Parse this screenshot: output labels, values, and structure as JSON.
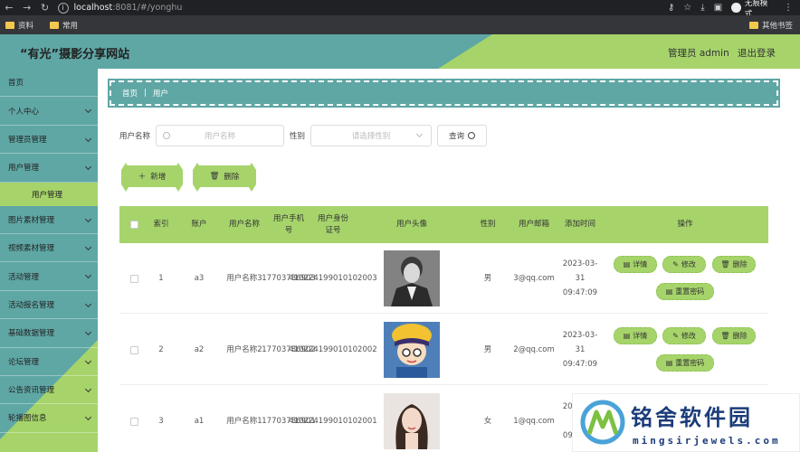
{
  "browser": {
    "url_host": "localhost",
    "url_path": ":8081/#/yonghu",
    "incognito_label": "无痕模式",
    "bookmarks": [
      "资料",
      "常用"
    ],
    "other_bookmarks": "其他书签"
  },
  "header": {
    "title": "“有光”摄影分享网站",
    "user": "管理员 admin",
    "logout": "退出登录"
  },
  "sidebar": {
    "items": [
      {
        "label": "首页",
        "chevron": false
      },
      {
        "label": "个人中心",
        "chevron": true
      },
      {
        "label": "管理员管理",
        "chevron": true
      },
      {
        "label": "用户管理",
        "chevron": true
      },
      {
        "label": "图片素材管理",
        "chevron": true
      },
      {
        "label": "视频素材管理",
        "chevron": true
      },
      {
        "label": "活动管理",
        "chevron": true
      },
      {
        "label": "活动报名管理",
        "chevron": true
      },
      {
        "label": "基础数据管理",
        "chevron": true
      },
      {
        "label": "论坛管理",
        "chevron": true
      },
      {
        "label": "公告资讯管理",
        "chevron": true
      },
      {
        "label": "轮播图信息",
        "chevron": true
      }
    ],
    "active_sub": "用户管理"
  },
  "breadcrumb": {
    "home": "首页",
    "current": "用户"
  },
  "search": {
    "name_label": "用户名称",
    "name_placeholder": "用户名称",
    "gender_label": "性别",
    "gender_placeholder": "请选择性别",
    "query_label": "查询"
  },
  "actions": {
    "add": "新增",
    "delete": "删除"
  },
  "table": {
    "headers": [
      "索引",
      "账户",
      "用户名称",
      "用户手机号",
      "用户身份证号",
      "用户头像",
      "性别",
      "用户邮箱",
      "添加时间",
      "操作"
    ],
    "rows": [
      {
        "index": "1",
        "account": "a3",
        "name": "用户名称3",
        "phone": "17703786903",
        "id": "410224199010102003",
        "gender": "男",
        "email": "3@qq.com",
        "time": "2023-03-31 09:47:09",
        "avatar": "male-photo"
      },
      {
        "index": "2",
        "account": "a2",
        "name": "用户名称2",
        "phone": "17703786902",
        "id": "410224199010102002",
        "gender": "男",
        "email": "2@qq.com",
        "time": "2023-03-31 09:47:09",
        "avatar": "cartoon-boy"
      },
      {
        "index": "3",
        "account": "a1",
        "name": "用户名称1",
        "phone": "17703786901",
        "id": "410224199010102001",
        "gender": "女",
        "email": "1@qq.com",
        "time": "2023-03-31 09:47:09",
        "avatar": "female-photo"
      }
    ],
    "ops": {
      "detail": "详情",
      "edit": "修改",
      "delete": "删除",
      "reset": "重置密码"
    }
  },
  "watermark": {
    "cn": "铭舍软件园",
    "en": "mingsirjewels.com"
  },
  "colors": {
    "teal": "#5fa7a5",
    "green": "#a6d46b"
  }
}
